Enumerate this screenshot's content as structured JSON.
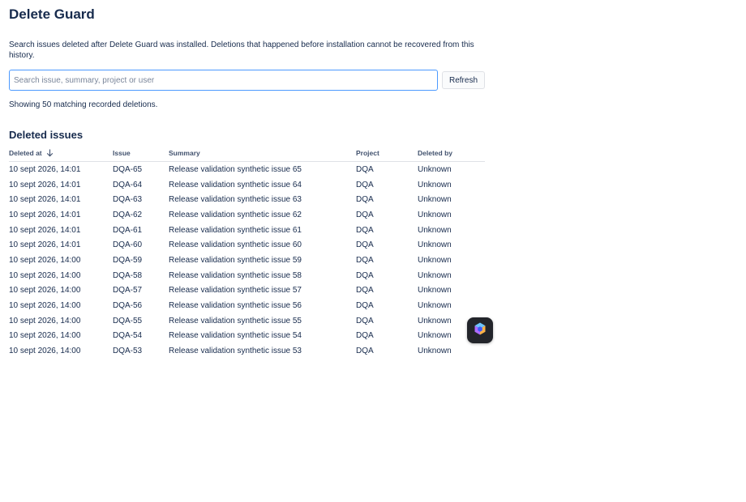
{
  "page": {
    "title": "Delete Guard",
    "intro": "Search issues deleted after Delete Guard was installed. Deletions that happened before installation cannot be recovered from this history.",
    "search_placeholder": "Search issue, summary, project or user",
    "search_value": "",
    "refresh_label": "Refresh",
    "result_count": "Showing 50 matching recorded deletions.",
    "section_title": "Deleted issues"
  },
  "table": {
    "headers": {
      "deleted_at": "Deleted at",
      "issue": "Issue",
      "summary": "Summary",
      "project": "Project",
      "deleted_by": "Deleted by"
    },
    "sort": "deleted_at-descending",
    "rows": [
      {
        "deleted_at": "10 sept 2026, 14:01",
        "issue": "DQA-65",
        "summary": "Release validation synthetic issue 65",
        "project": "DQA",
        "deleted_by": "Unknown"
      },
      {
        "deleted_at": "10 sept 2026, 14:01",
        "issue": "DQA-64",
        "summary": "Release validation synthetic issue 64",
        "project": "DQA",
        "deleted_by": "Unknown"
      },
      {
        "deleted_at": "10 sept 2026, 14:01",
        "issue": "DQA-63",
        "summary": "Release validation synthetic issue 63",
        "project": "DQA",
        "deleted_by": "Unknown"
      },
      {
        "deleted_at": "10 sept 2026, 14:01",
        "issue": "DQA-62",
        "summary": "Release validation synthetic issue 62",
        "project": "DQA",
        "deleted_by": "Unknown"
      },
      {
        "deleted_at": "10 sept 2026, 14:01",
        "issue": "DQA-61",
        "summary": "Release validation synthetic issue 61",
        "project": "DQA",
        "deleted_by": "Unknown"
      },
      {
        "deleted_at": "10 sept 2026, 14:01",
        "issue": "DQA-60",
        "summary": "Release validation synthetic issue 60",
        "project": "DQA",
        "deleted_by": "Unknown"
      },
      {
        "deleted_at": "10 sept 2026, 14:00",
        "issue": "DQA-59",
        "summary": "Release validation synthetic issue 59",
        "project": "DQA",
        "deleted_by": "Unknown"
      },
      {
        "deleted_at": "10 sept 2026, 14:00",
        "issue": "DQA-58",
        "summary": "Release validation synthetic issue 58",
        "project": "DQA",
        "deleted_by": "Unknown"
      },
      {
        "deleted_at": "10 sept 2026, 14:00",
        "issue": "DQA-57",
        "summary": "Release validation synthetic issue 57",
        "project": "DQA",
        "deleted_by": "Unknown"
      },
      {
        "deleted_at": "10 sept 2026, 14:00",
        "issue": "DQA-56",
        "summary": "Release validation synthetic issue 56",
        "project": "DQA",
        "deleted_by": "Unknown"
      },
      {
        "deleted_at": "10 sept 2026, 14:00",
        "issue": "DQA-55",
        "summary": "Release validation synthetic issue 55",
        "project": "DQA",
        "deleted_by": "Unknown"
      },
      {
        "deleted_at": "10 sept 2026, 14:00",
        "issue": "DQA-54",
        "summary": "Release validation synthetic issue 54",
        "project": "DQA",
        "deleted_by": "Unknown"
      },
      {
        "deleted_at": "10 sept 2026, 14:00",
        "issue": "DQA-53",
        "summary": "Release validation synthetic issue 53",
        "project": "DQA",
        "deleted_by": "Unknown"
      }
    ]
  },
  "floating_button": {
    "icon": "cube-logo-icon"
  },
  "colors": {
    "text": "#172b4d",
    "input_focus_border": "#4c9aff",
    "fab_background": "#23252b"
  }
}
